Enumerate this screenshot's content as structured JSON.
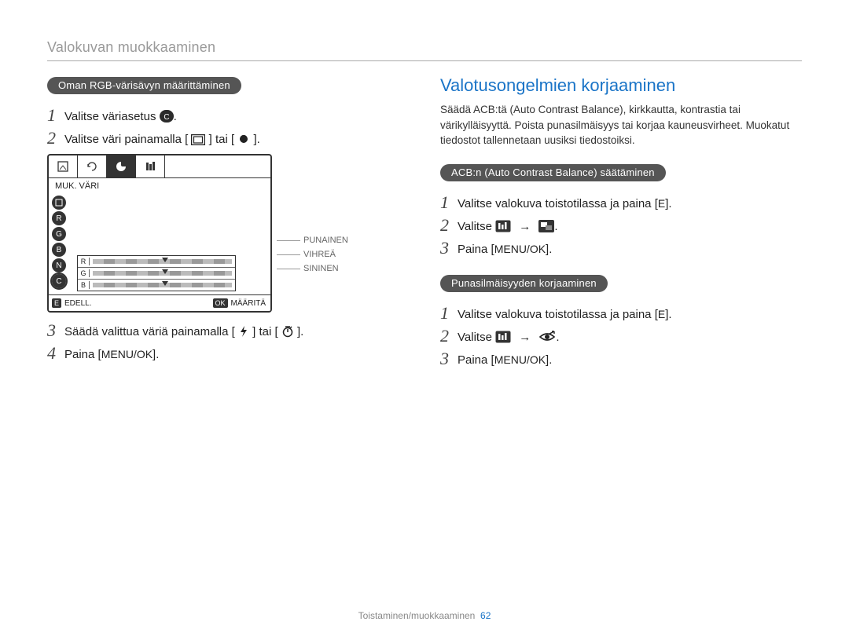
{
  "header": {
    "running_head": "Valokuvan muokkaaminen"
  },
  "left": {
    "pill": "Oman RGB-värisävyn määrittäminen",
    "steps": {
      "s1": "Valitse väriasetus ",
      "s1_icon": "custom-color-icon",
      "s2a": "Valitse väri painamalla [",
      "s2b": "] tai [",
      "s2c": "].",
      "s3a": "Säädä valittua väriä painamalla [",
      "s3b": "] tai [",
      "s3c": "].",
      "s4a": "Paina [",
      "s4b": "MENU/OK",
      "s4c": "]."
    },
    "screen": {
      "title": "MUK. VÄRI",
      "rows": {
        "r": "R",
        "g": "G",
        "b": "B"
      },
      "foot_back_key": "E",
      "foot_back_label": "EDELL.",
      "foot_ok_key": "OK",
      "foot_ok_label": "MÄÄRITÄ",
      "callout_red": "PUNAINEN",
      "callout_green": "VIHREÄ",
      "callout_blue": "SININEN"
    }
  },
  "right": {
    "heading": "Valotusongelmien korjaaminen",
    "intro": "Säädä ACB:tä (Auto Contrast Balance), kirkkautta, kontrastia tai värikylläisyyttä. Poista punasilmäisyys tai korjaa kauneusvirheet. Muokatut tiedostot tallennetaan uusiksi tiedostoiksi.",
    "acb": {
      "pill": "ACB:n (Auto Contrast Balance) säätäminen",
      "s1a": "Valitse valokuva toistotilassa ja paina [",
      "s1b": "E",
      "s1c": "].",
      "s2a": "Valitse ",
      "s3a": "Paina [",
      "s3b": "MENU/OK",
      "s3c": "]."
    },
    "redeye": {
      "pill": "Punasilmäisyyden korjaaminen",
      "s1a": "Valitse valokuva toistotilassa ja paina [",
      "s1b": "E",
      "s1c": "].",
      "s2a": "Valitse ",
      "s3a": "Paina [",
      "s3b": "MENU/OK",
      "s3c": "]."
    }
  },
  "footer": {
    "section": "Toistaminen/muokkaaminen",
    "page": "62"
  }
}
